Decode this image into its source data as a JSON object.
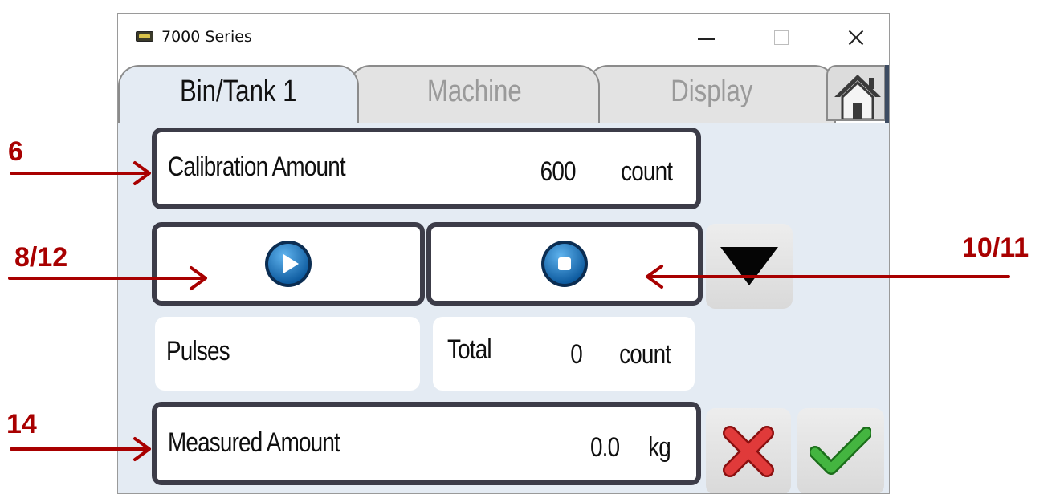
{
  "window": {
    "title": "7000 Series",
    "icon": "app-7000-icon",
    "controls": [
      "minimize-icon",
      "maximize-icon",
      "close-icon"
    ]
  },
  "tabs": [
    {
      "label": "Bin/Tank 1",
      "active": true
    },
    {
      "label": "Machine",
      "active": false
    },
    {
      "label": "Display",
      "active": false
    }
  ],
  "home_button": {
    "icon": "home-icon"
  },
  "calibration": {
    "label": "Calibration Amount",
    "value": "600",
    "unit": "count"
  },
  "controls": {
    "start_icon": "play-icon",
    "stop_icon": "stop-icon",
    "down_icon": "down-triangle-icon"
  },
  "pulses": {
    "label": "Pulses"
  },
  "total": {
    "label": "Total",
    "value": "0",
    "unit": "count"
  },
  "measured": {
    "label": "Measured Amount",
    "value": "0.0",
    "unit": "kg"
  },
  "actions": {
    "cancel_icon": "cancel-x-icon",
    "accept_icon": "checkmark-icon"
  },
  "annotations": [
    {
      "label": "6"
    },
    {
      "label": "8/12"
    },
    {
      "label": "10/11"
    },
    {
      "label": "14"
    }
  ],
  "colors": {
    "annotation": "#a80000",
    "panel_bg": "#e4ebf3",
    "box_border": "#3c3c48",
    "icon_blue": "#1e78c2",
    "cancel_red": "#d42a2a",
    "accept_green": "#2e9e2a"
  }
}
